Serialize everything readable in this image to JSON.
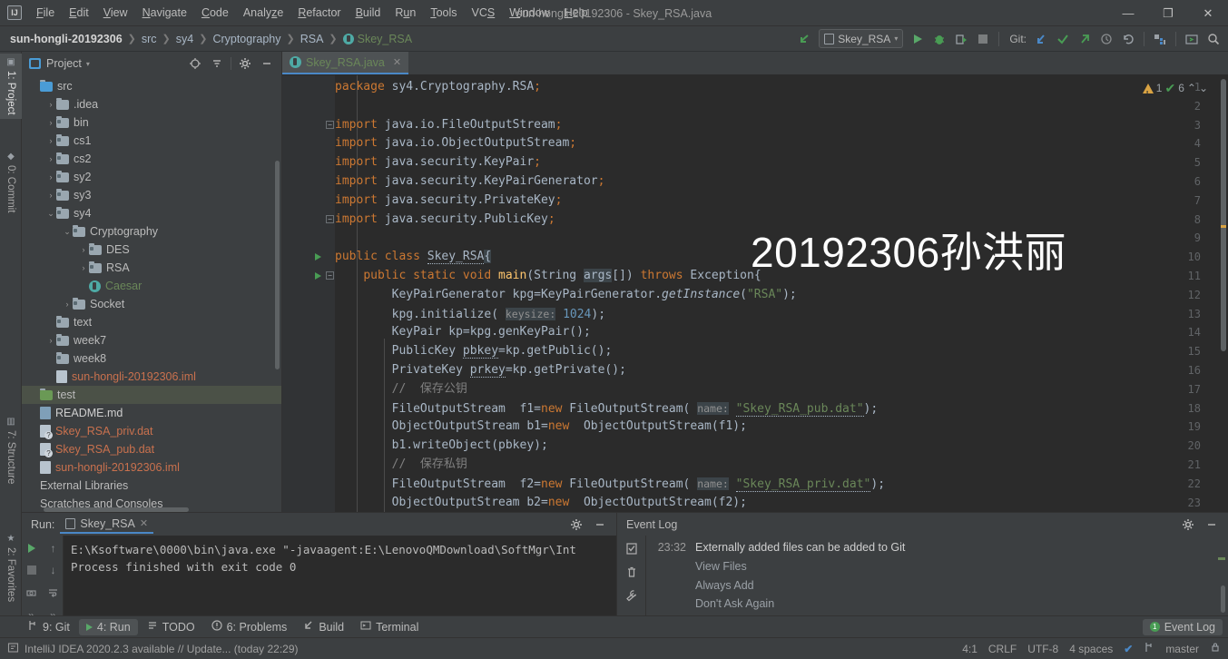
{
  "window": {
    "title": "sun-hongli-20192306 - Skey_RSA.java",
    "logo": "IJ",
    "minimize": "—",
    "maximize": "❐",
    "close": "✕"
  },
  "menubar": {
    "items": [
      {
        "label": "File",
        "mnemonic": "F"
      },
      {
        "label": "Edit",
        "mnemonic": "E"
      },
      {
        "label": "View",
        "mnemonic": "V"
      },
      {
        "label": "Navigate",
        "mnemonic": "N"
      },
      {
        "label": "Code",
        "mnemonic": "C"
      },
      {
        "label": "Analyze",
        "mnemonic": "z"
      },
      {
        "label": "Refactor",
        "mnemonic": "R"
      },
      {
        "label": "Build",
        "mnemonic": "B"
      },
      {
        "label": "Run",
        "mnemonic": "u"
      },
      {
        "label": "Tools",
        "mnemonic": "T"
      },
      {
        "label": "VCS",
        "mnemonic": "S"
      },
      {
        "label": "Window",
        "mnemonic": "W"
      },
      {
        "label": "Help",
        "mnemonic": "H"
      }
    ]
  },
  "navbar": {
    "breadcrumbs": [
      {
        "label": "sun-hongli-20192306",
        "style": "bold"
      },
      {
        "label": "src",
        "style": "plain"
      },
      {
        "label": "sy4",
        "style": "plain"
      },
      {
        "label": "Cryptography",
        "style": "plain"
      },
      {
        "label": "RSA",
        "style": "plain"
      },
      {
        "label": "Skey_RSA",
        "style": "green",
        "icon": "java-class-icon"
      }
    ],
    "separator": "❯",
    "run_configuration": "Skey_RSA",
    "git_label": "Git:",
    "icons": [
      "back-arrow-icon",
      "run-icon",
      "debug-icon",
      "run-coverage-icon",
      "stop-icon",
      "update-project-icon",
      "commit-icon",
      "push-icon",
      "history-icon",
      "rollback-icon",
      "project-structure-icon",
      "toggle-terminal-icon",
      "search-icon"
    ]
  },
  "left_strip": {
    "tabs": [
      {
        "label": "1: Project",
        "selected": true,
        "icon": "project-icon"
      },
      {
        "label": "0: Commit",
        "selected": false,
        "icon": "commit-icon"
      },
      {
        "label": "7: Structure",
        "selected": false,
        "icon": "structure-icon"
      },
      {
        "label": "2: Favorites",
        "selected": false,
        "icon": "star-icon"
      }
    ]
  },
  "project_panel": {
    "title": "Project",
    "chevron": "▾",
    "actions": [
      "locate-icon",
      "collapse-all-icon",
      "gear-icon",
      "hide-icon"
    ],
    "tree": [
      {
        "label": "src",
        "indent": 0,
        "arrow": "",
        "icon": "folder-src",
        "color": "plain"
      },
      {
        "label": ".idea",
        "indent": 1,
        "arrow": "›",
        "icon": "folder",
        "color": "plain"
      },
      {
        "label": "bin",
        "indent": 1,
        "arrow": "›",
        "icon": "folder-pkg",
        "color": "plain"
      },
      {
        "label": "cs1",
        "indent": 1,
        "arrow": "›",
        "icon": "folder-pkg",
        "color": "plain"
      },
      {
        "label": "cs2",
        "indent": 1,
        "arrow": "›",
        "icon": "folder-pkg",
        "color": "plain"
      },
      {
        "label": "sy2",
        "indent": 1,
        "arrow": "›",
        "icon": "folder-pkg",
        "color": "plain"
      },
      {
        "label": "sy3",
        "indent": 1,
        "arrow": "›",
        "icon": "folder-pkg",
        "color": "plain"
      },
      {
        "label": "sy4",
        "indent": 1,
        "arrow": "⌄",
        "icon": "folder-pkg",
        "color": "plain"
      },
      {
        "label": "Cryptography",
        "indent": 2,
        "arrow": "⌄",
        "icon": "folder-pkg",
        "color": "plain"
      },
      {
        "label": "DES",
        "indent": 3,
        "arrow": "›",
        "icon": "folder-pkg",
        "color": "plain"
      },
      {
        "label": "RSA",
        "indent": 3,
        "arrow": "›",
        "icon": "folder-pkg",
        "color": "plain"
      },
      {
        "label": "Caesar",
        "indent": 3,
        "arrow": "",
        "icon": "java-class",
        "color": "green"
      },
      {
        "label": "Socket",
        "indent": 2,
        "arrow": "›",
        "icon": "folder-pkg",
        "color": "plain"
      },
      {
        "label": "text",
        "indent": 1,
        "arrow": "",
        "icon": "folder-pkg",
        "color": "plain"
      },
      {
        "label": "week7",
        "indent": 1,
        "arrow": "›",
        "icon": "folder-pkg",
        "color": "plain"
      },
      {
        "label": "week8",
        "indent": 1,
        "arrow": "",
        "icon": "folder-pkg",
        "color": "plain"
      },
      {
        "label": "sun-hongli-20192306.iml",
        "indent": 1,
        "arrow": "",
        "icon": "file-iml",
        "color": "orange"
      },
      {
        "label": "test",
        "indent": 0,
        "arrow": "",
        "icon": "folder-test",
        "color": "plain",
        "selected": true
      },
      {
        "label": "README.md",
        "indent": 0,
        "arrow": "",
        "icon": "file-md",
        "color": "white"
      },
      {
        "label": "Skey_RSA_priv.dat",
        "indent": 0,
        "arrow": "",
        "icon": "file-unknown",
        "color": "orange"
      },
      {
        "label": "Skey_RSA_pub.dat",
        "indent": 0,
        "arrow": "",
        "icon": "file-unknown",
        "color": "orange"
      },
      {
        "label": "sun-hongli-20192306.iml",
        "indent": 0,
        "arrow": "",
        "icon": "file-iml",
        "color": "orange"
      },
      {
        "label": "External Libraries",
        "indent": 0,
        "arrow": "",
        "icon": "none",
        "color": "plain"
      },
      {
        "label": "Scratches and Consoles",
        "indent": 0,
        "arrow": "",
        "icon": "none",
        "color": "plain"
      }
    ]
  },
  "editor": {
    "tab": {
      "label": "Skey_RSA.java",
      "close": "✕",
      "icon": "java-class-icon"
    },
    "watermark": "20192306孙洪丽",
    "inspections": {
      "warning_count": "1",
      "ok_count": "6",
      "up": "⌃",
      "down": "⌄"
    },
    "lines": [
      {
        "n": "1",
        "runmark": false,
        "fold": "",
        "html": "<span class='k'>package</span> <span class='t'>sy4.Cryptography.RSA</span><span class='k'>;</span>"
      },
      {
        "n": "2",
        "runmark": false,
        "fold": "",
        "html": ""
      },
      {
        "n": "3",
        "runmark": false,
        "fold": "−",
        "html": "<span class='k'>import</span> <span class='t'>java.io.FileOutputStream</span><span class='k'>;</span>"
      },
      {
        "n": "4",
        "runmark": false,
        "fold": "",
        "html": "<span class='k'>import</span> <span class='t'>java.io.ObjectOutputStream</span><span class='k'>;</span>"
      },
      {
        "n": "5",
        "runmark": false,
        "fold": "",
        "html": "<span class='k'>import</span> <span class='t'>java.security.KeyPair</span><span class='k'>;</span>"
      },
      {
        "n": "6",
        "runmark": false,
        "fold": "",
        "html": "<span class='k'>import</span> <span class='t'>java.security.KeyPairGenerator</span><span class='k'>;</span>"
      },
      {
        "n": "7",
        "runmark": false,
        "fold": "",
        "html": "<span class='k'>import</span> <span class='t'>java.security.PrivateKey</span><span class='k'>;</span>"
      },
      {
        "n": "8",
        "runmark": false,
        "fold": "−",
        "html": "<span class='k'>import</span> <span class='t'>java.security.PublicKey</span><span class='k'>;</span>"
      },
      {
        "n": "9",
        "runmark": false,
        "fold": "",
        "html": ""
      },
      {
        "n": "10",
        "runmark": true,
        "fold": "",
        "html": "<span class='k'>public class</span> <span class='t wavy'>Skey_RSA</span><span class='hl t'>{</span>"
      },
      {
        "n": "11",
        "runmark": true,
        "fold": "−",
        "html": "    <span class='k'>public static void</span> <span class='m'>main</span><span class='t'>(String </span><span class='hl t'>args</span><span class='t'>[]) </span><span class='k'>throws</span><span class='t'> Exception{</span>"
      },
      {
        "n": "12",
        "runmark": false,
        "fold": "",
        "html": "        <span class='t'>KeyPairGenerator kpg=KeyPairGenerator.</span><span class='i'>getInstance</span><span class='t'>(</span><span class='s'>\"RSA\"</span><span class='t'>);</span>"
      },
      {
        "n": "13",
        "runmark": false,
        "fold": "",
        "html": "        <span class='t'>kpg.initialize( </span><span class='param hl'>keysize:</span><span class='t'> </span><span class='n'>1024</span><span class='t'>);</span>"
      },
      {
        "n": "14",
        "runmark": false,
        "fold": "",
        "html": "        <span class='t'>KeyPair kp=kpg.genKeyPair();</span>"
      },
      {
        "n": "15",
        "runmark": false,
        "fold": "",
        "html": "        <span class='t'>PublicKey </span><span class='t wavy'>pbkey</span><span class='t'>=kp.getPublic();</span>"
      },
      {
        "n": "16",
        "runmark": false,
        "fold": "",
        "html": "        <span class='t'>PrivateKey </span><span class='t wavy'>prkey</span><span class='t'>=kp.getPrivate();</span>"
      },
      {
        "n": "17",
        "runmark": false,
        "fold": "",
        "html": "        <span class='c'>//  保存公钥</span>"
      },
      {
        "n": "18",
        "runmark": false,
        "fold": "",
        "html": "        <span class='t'>FileOutputStream  f1=</span><span class='k'>new</span><span class='t'> FileOutputStream( </span><span class='param hl'>name:</span><span class='t'> </span><span class='s wavy'>\"Skey_RSA_pub.dat\"</span><span class='t'>);</span>"
      },
      {
        "n": "19",
        "runmark": false,
        "fold": "",
        "html": "        <span class='t'>ObjectOutputStream b1=</span><span class='k'>new</span><span class='t'>  ObjectOutputStream(f1);</span>"
      },
      {
        "n": "20",
        "runmark": false,
        "fold": "",
        "html": "        <span class='t'>b1.writeObject(pbkey);</span>"
      },
      {
        "n": "21",
        "runmark": false,
        "fold": "",
        "html": "        <span class='c'>//  保存私钥</span>"
      },
      {
        "n": "22",
        "runmark": false,
        "fold": "",
        "html": "        <span class='t'>FileOutputStream  f2=</span><span class='k'>new</span><span class='t'> FileOutputStream( </span><span class='param hl'>name:</span><span class='t'> </span><span class='s wavy'>\"Skey_RSA_priv.dat\"</span><span class='t'>);</span>"
      },
      {
        "n": "23",
        "runmark": false,
        "fold": "",
        "html": "        <span class='t'>ObjectOutputStream b2=</span><span class='k'>new</span><span class='t'>  ObjectOutputStream(f2);</span>"
      }
    ]
  },
  "run_panel": {
    "label": "Run:",
    "tab": "Skey_RSA",
    "tab_close": "✕",
    "actions": [
      "gear-icon",
      "hide-icon"
    ],
    "tools": [
      "rerun-icon",
      "scroll-up-icon",
      "stop-icon",
      "scroll-down-icon",
      "print-icon",
      "soft-wrap-icon",
      "more-icon",
      "more2-icon"
    ],
    "console": [
      "E:\\Ksoftware\\0000\\bin\\java.exe \"-javaagent:E:\\LenovoQMDownload\\SoftMgr\\Int",
      "",
      "Process finished with exit code 0"
    ]
  },
  "event_log": {
    "title": "Event Log",
    "actions": [
      "gear-icon",
      "hide-icon"
    ],
    "tools": [
      "mark-read-icon",
      "trash-icon",
      "wrench-icon"
    ],
    "entries": [
      {
        "time": "23:32",
        "text": "Externally added files can be added to Git",
        "type": "message"
      },
      {
        "time": "",
        "text": "View Files",
        "type": "link"
      },
      {
        "time": "",
        "text": "Always Add",
        "type": "link"
      },
      {
        "time": "",
        "text": "Don't Ask Again",
        "type": "link"
      }
    ]
  },
  "bottom_tabs": {
    "items": [
      {
        "label": "9: Git",
        "mnemonic": "9",
        "icon": "git-icon",
        "selected": false
      },
      {
        "label": "4: Run",
        "mnemonic": "4",
        "icon": "run-icon",
        "selected": true
      },
      {
        "label": "TODO",
        "mnemonic": "",
        "icon": "todo-icon",
        "selected": false
      },
      {
        "label": "6: Problems",
        "mnemonic": "6",
        "icon": "problems-icon",
        "selected": false
      },
      {
        "label": "Build",
        "mnemonic": "",
        "icon": "build-icon",
        "selected": false
      },
      {
        "label": "Terminal",
        "mnemonic": "",
        "icon": "terminal-icon",
        "selected": false
      }
    ],
    "event_log_badge": {
      "count": "1",
      "label": "Event Log"
    }
  },
  "statusbar": {
    "message": "IntelliJ IDEA 2020.2.3 available // Update... (today 22:29)",
    "caret": "4:1",
    "line_separator": "CRLF",
    "encoding": "UTF-8",
    "indent": "4 spaces",
    "vcs_check": "✔",
    "branch": "master",
    "lock_icon": "lock-icon"
  },
  "colors": {
    "panel_bg": "#3c3f41",
    "editor_bg": "#2b2b2b",
    "gutter_bg": "#313335",
    "accent_blue": "#4a88c7",
    "keyword_orange": "#cc7832",
    "string_green": "#6a8759",
    "number_blue": "#6897bb",
    "method_yellow": "#ffc66d",
    "text_gray": "#a9b7c6",
    "selection_green": "#4b5147",
    "warning_yellow": "#d9a343",
    "ok_green": "#499c54"
  }
}
